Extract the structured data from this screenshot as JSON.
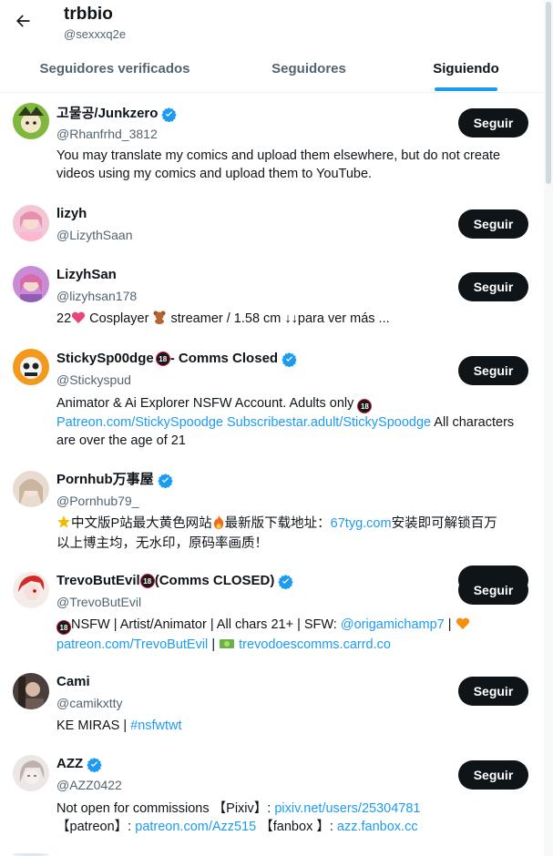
{
  "header": {
    "title": "trbbio",
    "subtitle": "@sexxxq2e"
  },
  "tabs": [
    {
      "label": "Seguidores verificados",
      "active": false
    },
    {
      "label": "Seguidores",
      "active": false
    },
    {
      "label": "Siguiendo",
      "active": true
    }
  ],
  "follow_label": "Seguir",
  "accent_color": "#1d9bf0",
  "users": [
    {
      "name": "고물공/Junkzero",
      "verified": true,
      "handle": "@Rhanfrhd_3812",
      "bio_line1": "You may translate my comics and upload them elsewhere, but do not create",
      "bio_line2": "videos using my comics and upload them to YouTube."
    },
    {
      "name": "lizyh",
      "verified": false,
      "handle": "@LizythSaan"
    },
    {
      "name": "LizyhSan",
      "verified": false,
      "handle": "@lizyhsan178",
      "bio_part1": "22",
      "bio_part2": " Cosplayer ",
      "bio_part3": " streamer / 1.58 cm ↓↓para ver más ..."
    },
    {
      "name": "StickySp00dge",
      "name_suffix": " - Comms Closed",
      "verified": true,
      "handle": "@Stickyspud",
      "bio_line1": "Animator & Ai Explorer NSFW Account. Adults only ",
      "bio_link1": "Patreon.com/StickySpoodge",
      "bio_link2": "Subscribestar.adult/StickySpoodge",
      "bio_line2_rest": " All characters",
      "bio_line3": "are over the age of 21"
    },
    {
      "name": "Pornhub万事屋",
      "verified": true,
      "handle": "@Pornhub79_",
      "bio_part1": "中文版P站最大黄色网站",
      "bio_part2": "最新版下载地址：",
      "bio_link": "67tyg.com",
      "bio_part3": "安装即可解锁百万",
      "bio_line2": "以上博主均，无水印，原码率画质！"
    },
    {
      "name": "TrevoButEvil",
      "name_suffix": "(Comms CLOSED)",
      "verified": true,
      "handle": "@TrevoButEvil",
      "bio_part1": "NSFW | Artist/Animator | All chars 21+ | SFW: ",
      "bio_link1": "@origamichamp7",
      "bio_part2": " | ",
      "bio_link2": "patreon.com/TrevoButEvil",
      "bio_part3": " | ",
      "bio_link3": "trevodoescomms.carrd.co"
    },
    {
      "name": "Cami",
      "verified": false,
      "handle": "@camikxtty",
      "bio_part1": "KE MIRAS | ",
      "bio_link": "#nsfwtwt"
    },
    {
      "name": "AZZ",
      "verified": true,
      "handle": "@AZZ0422",
      "bio_part1": "Not open for commissions 【Pixiv】: ",
      "bio_link1": "pixiv.net/users/25304781",
      "bio_part2": "【patreon】: ",
      "bio_link2": "patreon.com/Azz515",
      "bio_part3": " 【fanbox 】: ",
      "bio_link3": "azz.fanbox.cc"
    }
  ]
}
